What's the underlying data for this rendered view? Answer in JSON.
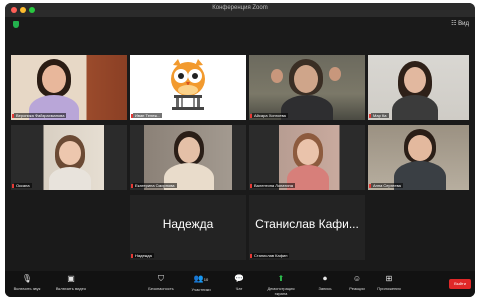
{
  "window": {
    "title": "Конференция Zoom"
  },
  "view_button": "☷ Вид",
  "participants": [
    {
      "name": "Вероника Файзрахманова",
      "big": ""
    },
    {
      "name": "Иван Тележ...",
      "big": ""
    },
    {
      "name": "Айсара Хонгоева",
      "big": ""
    },
    {
      "name": "Мар Ка",
      "big": ""
    },
    {
      "name": "Оксана",
      "big": ""
    },
    {
      "name": "Екатерина Смирнова",
      "big": ""
    },
    {
      "name": "Валентина Лопатина",
      "big": ""
    },
    {
      "name": "Анна Сергеева",
      "big": ""
    },
    {
      "name": "Надежда",
      "big": "Надежда"
    },
    {
      "name": "Станислав Кафин",
      "big": "Станислав Кафи..."
    }
  ],
  "toolbar": {
    "mute": "Включить звук",
    "video": "Включить видео",
    "security": "Безопасность",
    "participants": "Участники",
    "participants_count": "10",
    "chat": "Чат",
    "share": "Демонстрация экрана",
    "record": "Запись",
    "reactions": "Реакции",
    "apps": "Приложения",
    "end": "Выйти"
  },
  "icons": {
    "mic": "mic-icon",
    "video": "video-icon",
    "security": "shield-icon",
    "participants": "people-icon",
    "chat": "chat-icon",
    "share": "share-screen-icon",
    "record": "record-icon",
    "reactions": "smile-icon",
    "apps": "apps-icon"
  },
  "colors": {
    "active_speaker": "#c7e245",
    "end_button": "#e02828",
    "share_green": "#2dbd4e"
  }
}
